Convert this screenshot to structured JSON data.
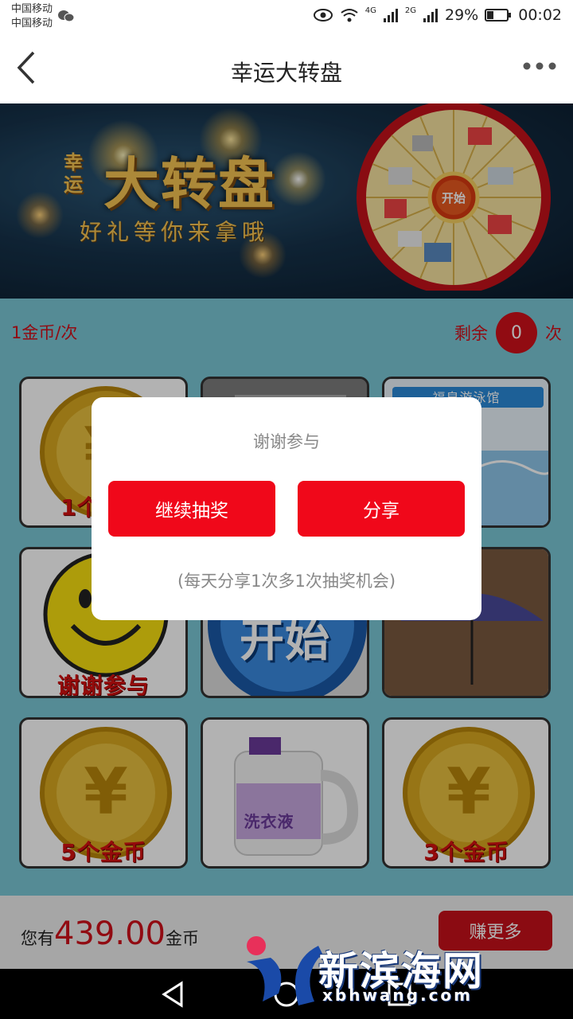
{
  "status_bar": {
    "carrier_1": "中国移动",
    "carrier_2": "中国移动",
    "net_1": "4G",
    "net_2": "2G",
    "battery": "29%",
    "time": "00:02"
  },
  "header": {
    "title": "幸运大转盘"
  },
  "banner": {
    "small_text": "幸运",
    "title": "大转盘",
    "subtitle": "好礼等你来拿哦",
    "wheel_center": "开始"
  },
  "game": {
    "cost": "1金币/次",
    "remaining_label": "剩余",
    "remaining_count": "0",
    "remaining_unit": "次",
    "tiles": [
      {
        "label": "1个金币"
      },
      {
        "label": ""
      },
      {
        "label": "福泉游泳馆"
      },
      {
        "label": "谢谢参与"
      },
      {
        "label": "开始"
      },
      {
        "label": ""
      },
      {
        "label": "5个金币"
      },
      {
        "label": "洗衣液"
      },
      {
        "label": "3个金币"
      }
    ]
  },
  "footer": {
    "balance_prefix": "您有",
    "balance_value": "439.00",
    "balance_unit": "金币",
    "earn_more": "赚更多"
  },
  "dialog": {
    "message": "谢谢参与",
    "continue_label": "继续抽奖",
    "share_label": "分享",
    "note": "(每天分享1次多1次抽奖机会)"
  },
  "watermark": {
    "text": "新滨海网",
    "url": "xbhwang.com"
  },
  "colors": {
    "accent": "#f0081a",
    "brand_red": "#d0101a",
    "game_bg": "#7ac7d6"
  }
}
